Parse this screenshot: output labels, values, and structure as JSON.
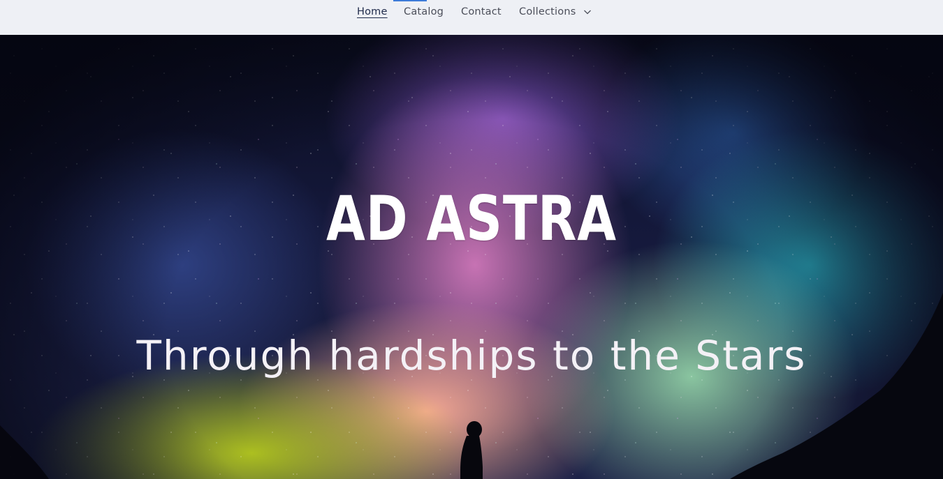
{
  "nav": {
    "items": [
      {
        "label": "Home",
        "active": true
      },
      {
        "label": "Catalog",
        "active": false
      },
      {
        "label": "Contact",
        "active": false
      },
      {
        "label": "Collections",
        "active": false,
        "has_dropdown": true
      }
    ],
    "dropdown_icon": "chevron-down-icon"
  },
  "hero": {
    "title": "AD ASTRA",
    "subtitle": "Through hardships to the Stars"
  },
  "colors": {
    "nav_background": "#eef0f5",
    "nav_text": "#4c4f5a",
    "nav_active_text": "#1f2a4a",
    "focus_indicator": "#3d7bd9",
    "hero_text": "#ffffff"
  }
}
